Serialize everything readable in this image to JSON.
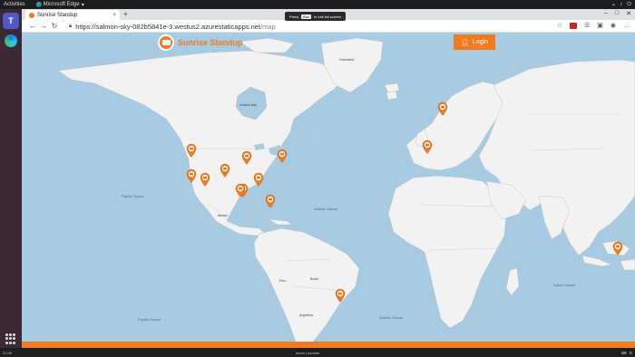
{
  "system": {
    "activities": "Activities",
    "app_name": "Microsoft Edge",
    "app_menu_arrow": "▾"
  },
  "browser": {
    "tab_title": "Sunrise Standup",
    "tab_close": "×",
    "new_tab": "+",
    "url_host": "https://salmon-sky-082b5841e-3.westus2.azurestaticapps.net",
    "url_path": "/map",
    "fullscreen_notice": {
      "press": "Press",
      "key": "Esc",
      "suffix": "to exit full screen"
    },
    "icons": [
      "back-icon",
      "forward-icon",
      "refresh-icon",
      "lock-icon",
      "favorite-icon",
      "extension-icon",
      "collections-icon",
      "profile-icon",
      "more-icon"
    ]
  },
  "page": {
    "brand": "Sunrise Standup",
    "login_label": "Login",
    "accent": "#f07b20",
    "ocean": "#a6cbe3",
    "land": "#f2f2f2",
    "oceans": [
      {
        "key": "pacific_n",
        "label": "Pacific Ocean"
      },
      {
        "key": "atlantic_n",
        "label": "Atlantic Ocean"
      },
      {
        "key": "pacific_s",
        "label": "Pacific Ocean"
      },
      {
        "key": "atlantic_s",
        "label": "Atlantic Ocean"
      },
      {
        "key": "indian",
        "label": "Indian Ocean"
      }
    ],
    "places": [
      {
        "key": "hudson",
        "label": "Hudson Bay"
      },
      {
        "key": "mexico",
        "label": "Mexico"
      },
      {
        "key": "brazil",
        "label": "Brazil"
      },
      {
        "key": "peru",
        "label": "Peru"
      },
      {
        "key": "argentina",
        "label": "Argentina"
      },
      {
        "key": "greenland",
        "label": "Greenland"
      }
    ],
    "pins": [
      {
        "key": "seattle"
      },
      {
        "key": "sanfrancisco"
      },
      {
        "key": "losangeles"
      },
      {
        "key": "denver"
      },
      {
        "key": "dallas"
      },
      {
        "key": "chicago"
      },
      {
        "key": "newyork"
      },
      {
        "key": "atlanta"
      },
      {
        "key": "minneapolis"
      },
      {
        "key": "houston"
      },
      {
        "key": "norway"
      },
      {
        "key": "paris"
      },
      {
        "key": "brazil"
      },
      {
        "key": "singapore"
      }
    ]
  },
  "taskbar": {
    "left": "22:49",
    "center": "azure | sunrise"
  }
}
